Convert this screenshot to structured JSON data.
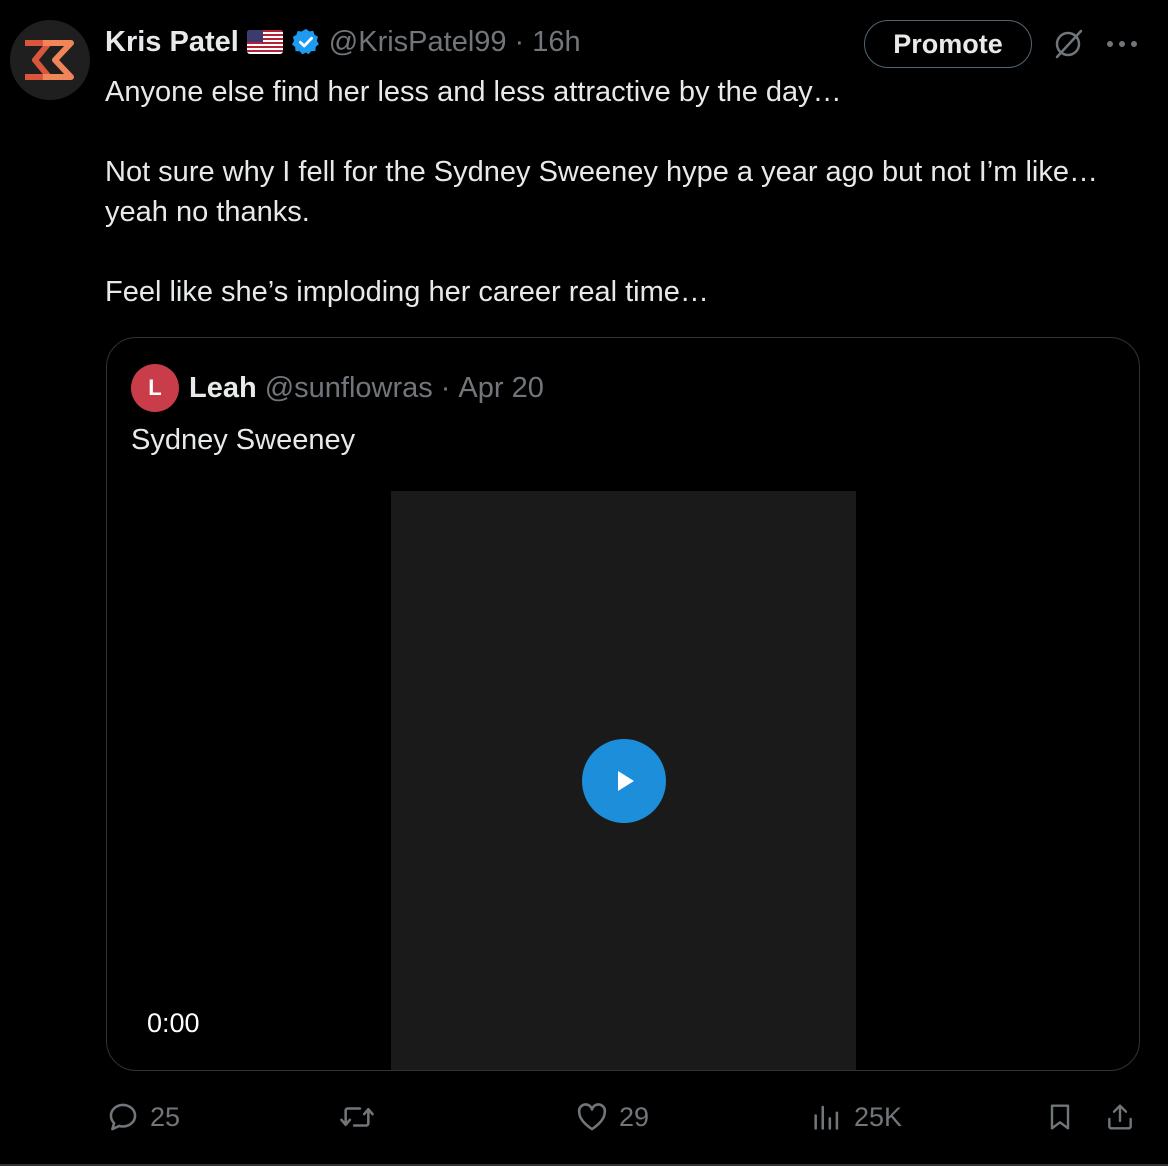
{
  "author": {
    "name": "Kris Patel",
    "handle": "@KrisPatel99",
    "separator": "·",
    "time": "16h",
    "avatar_icon": "zigzag-logo-icon",
    "flag_icon": "us-flag-icon",
    "verified_icon": "verified-badge-icon",
    "verified_color": "#1d9bf0"
  },
  "promote_label": "Promote",
  "top_icons": [
    "grok-icon",
    "more-icon"
  ],
  "body_text": "Anyone else find her less and less attractive by the day…\n\nNot sure why I fell for the Sydney Sweeney hype a year ago but not I’m like… yeah no thanks.\n\nFeel like she’s imploding her career real time…",
  "quote": {
    "name": "Leah",
    "handle": "@sunflowras",
    "separator": "·",
    "date": "Apr 20",
    "text": "Sydney Sweeney",
    "avatar_initial": "L",
    "video_time": "0:00",
    "media_icon": "play-icon"
  },
  "actions": {
    "replies": "25",
    "reposts": "",
    "likes": "29",
    "views": "25K",
    "icons": [
      "reply-icon",
      "repost-icon",
      "like-icon",
      "views-icon",
      "bookmark-icon",
      "share-icon"
    ]
  },
  "colors": {
    "background": "#000000",
    "text": "#e7e9ea",
    "muted": "#71767b",
    "border": "#2f3336",
    "accent": "#1d9bf0"
  }
}
